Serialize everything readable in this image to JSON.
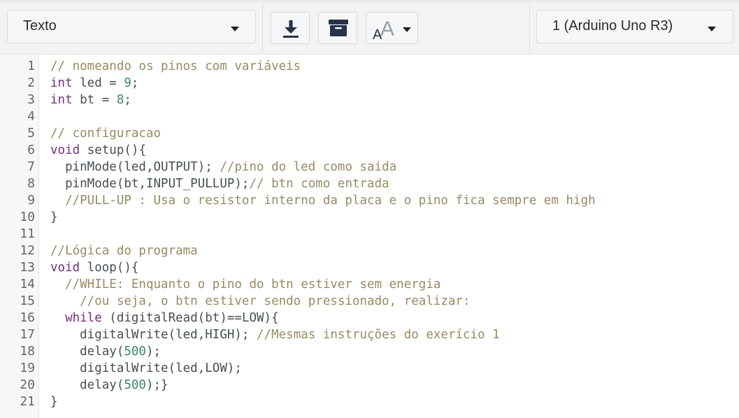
{
  "toolbar": {
    "mode_dropdown": {
      "value": "Texto"
    },
    "download_button": {
      "icon": "download-icon"
    },
    "library_button": {
      "icon": "archive-box-icon"
    },
    "font_size_button": {
      "icon": "font-size-icon",
      "glyph_small": "A",
      "glyph_large": "A"
    },
    "board_dropdown": {
      "value": "1 (Arduino Uno R3)"
    }
  },
  "editor": {
    "line_numbers": [
      "1",
      "2",
      "3",
      "4",
      "5",
      "6",
      "7",
      "8",
      "9",
      "10",
      "11",
      "12",
      "13",
      "14",
      "15",
      "16",
      "17",
      "18",
      "19",
      "20",
      "21"
    ],
    "lines": [
      [
        {
          "t": "comment",
          "v": "// nomeando os pinos com variáveis"
        }
      ],
      [
        {
          "t": "kw",
          "v": "int"
        },
        {
          "t": "plain",
          "v": " led = "
        },
        {
          "t": "num",
          "v": "9"
        },
        {
          "t": "plain",
          "v": ";"
        }
      ],
      [
        {
          "t": "kw",
          "v": "int"
        },
        {
          "t": "plain",
          "v": " bt = "
        },
        {
          "t": "num",
          "v": "8"
        },
        {
          "t": "plain",
          "v": ";"
        }
      ],
      [],
      [
        {
          "t": "comment",
          "v": "// configuracao"
        }
      ],
      [
        {
          "t": "kw",
          "v": "void"
        },
        {
          "t": "plain",
          "v": " setup(){"
        }
      ],
      [
        {
          "t": "plain",
          "v": "  pinMode(led,OUTPUT); "
        },
        {
          "t": "comment",
          "v": "//pino do led como saida"
        }
      ],
      [
        {
          "t": "plain",
          "v": "  pinMode(bt,INPUT_PULLUP);"
        },
        {
          "t": "comment",
          "v": "// btn como entrada"
        }
      ],
      [
        {
          "t": "comment",
          "v": "  //PULL-UP : Usa o resistor interno da placa e o pino fica sempre em high"
        }
      ],
      [
        {
          "t": "plain",
          "v": "}"
        }
      ],
      [],
      [
        {
          "t": "comment",
          "v": "//Lógica do programa"
        }
      ],
      [
        {
          "t": "kw",
          "v": "void"
        },
        {
          "t": "plain",
          "v": " loop(){"
        }
      ],
      [
        {
          "t": "comment",
          "v": "  //WHILE: Enquanto o pino do btn estiver sem energia"
        }
      ],
      [
        {
          "t": "comment",
          "v": "    //ou seja, o btn estiver sendo pressionado, realizar:"
        }
      ],
      [
        {
          "t": "plain",
          "v": "  "
        },
        {
          "t": "kw",
          "v": "while"
        },
        {
          "t": "plain",
          "v": " (digitalRead(bt)==LOW){"
        }
      ],
      [
        {
          "t": "plain",
          "v": "    digitalWrite(led,HIGH); "
        },
        {
          "t": "comment",
          "v": "//Mesmas instruções do exerício 1"
        }
      ],
      [
        {
          "t": "plain",
          "v": "    delay("
        },
        {
          "t": "num",
          "v": "500"
        },
        {
          "t": "plain",
          "v": ");"
        }
      ],
      [
        {
          "t": "plain",
          "v": "    digitalWrite(led,LOW);"
        }
      ],
      [
        {
          "t": "plain",
          "v": "    delay("
        },
        {
          "t": "num",
          "v": "500"
        },
        {
          "t": "plain",
          "v": ");}"
        }
      ],
      [
        {
          "t": "plain",
          "v": "}"
        }
      ]
    ]
  },
  "colors": {
    "comment": "#9a8a5f",
    "keyword": "#7a2a84",
    "number": "#2f8c6b",
    "plain": "#333333",
    "toolbar_bg": "#f2f3f5",
    "gutter_bg": "#f7f7f8"
  }
}
